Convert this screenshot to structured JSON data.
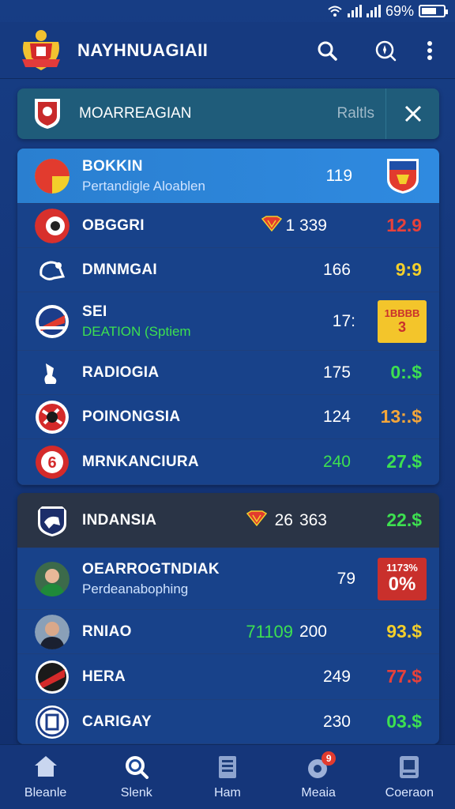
{
  "status": {
    "battery_text": "69%",
    "battery_level": 0.69
  },
  "app_bar": {
    "title": "NAYHNUAGIAII"
  },
  "search": {
    "label": "MOARREAGIAN",
    "hint": "Raltls"
  },
  "colors": {
    "green": "#3de050",
    "red": "#e8413a",
    "yellow": "#f3cf2b",
    "orange": "#f4a63a",
    "white": "#ffffff"
  },
  "group1": [
    {
      "name": "BOKKIN",
      "sub": "Pertandigle Aloablen",
      "count": "119",
      "value": "",
      "highlight": true
    },
    {
      "name": "OBGGRI",
      "sub": "",
      "count": "1 339",
      "value": "12.9",
      "value_color": "red"
    },
    {
      "name": "DMNMGAI",
      "sub": "",
      "count": "166",
      "value": "9:9",
      "value_color": "yellow"
    },
    {
      "name": "SEI",
      "sub": "DEATION (Sptiem",
      "count": "17:",
      "value": "",
      "tile_line1": "1BBBB",
      "tile_line2": "3"
    },
    {
      "name": "RADIOGIA",
      "sub": "",
      "count": "175",
      "value": "0:.$",
      "value_color": "green"
    },
    {
      "name": "POINONGSIA",
      "sub": "",
      "count": "124",
      "value": "13:.$",
      "value_color": "orange"
    },
    {
      "name": "MRNKANCIURA",
      "sub": "",
      "count": "240",
      "count_color": "green",
      "value": "27.$",
      "value_color": "green"
    }
  ],
  "group2": [
    {
      "name": "INDANSIA",
      "sub": "",
      "count": "363",
      "extra": "26",
      "value": "22.$",
      "value_color": "green",
      "dark": true
    },
    {
      "name": "OEARROGTNDIAK",
      "sub": "Perdeanabophing",
      "count": "79",
      "value": "",
      "tile_line1": "1173%",
      "tile_line2": "0%"
    },
    {
      "name": "RNIAO",
      "sub": "",
      "count": "200",
      "extra": "71109",
      "value": "93.$",
      "value_color": "yellow"
    },
    {
      "name": "HERA",
      "sub": "",
      "count": "249",
      "value": "77.$",
      "value_color": "red"
    },
    {
      "name": "CARIGAY",
      "sub": "",
      "count": "230",
      "value": "03.$",
      "value_color": "green"
    }
  ],
  "tabs": [
    {
      "label": "Bleanle",
      "icon": "home-icon"
    },
    {
      "label": "Slenk",
      "icon": "search-icon"
    },
    {
      "label": "Ham",
      "icon": "document-icon"
    },
    {
      "label": "Meaia",
      "icon": "media-icon",
      "notification": "9"
    },
    {
      "label": "Coeraon",
      "icon": "profile-card-icon"
    }
  ]
}
